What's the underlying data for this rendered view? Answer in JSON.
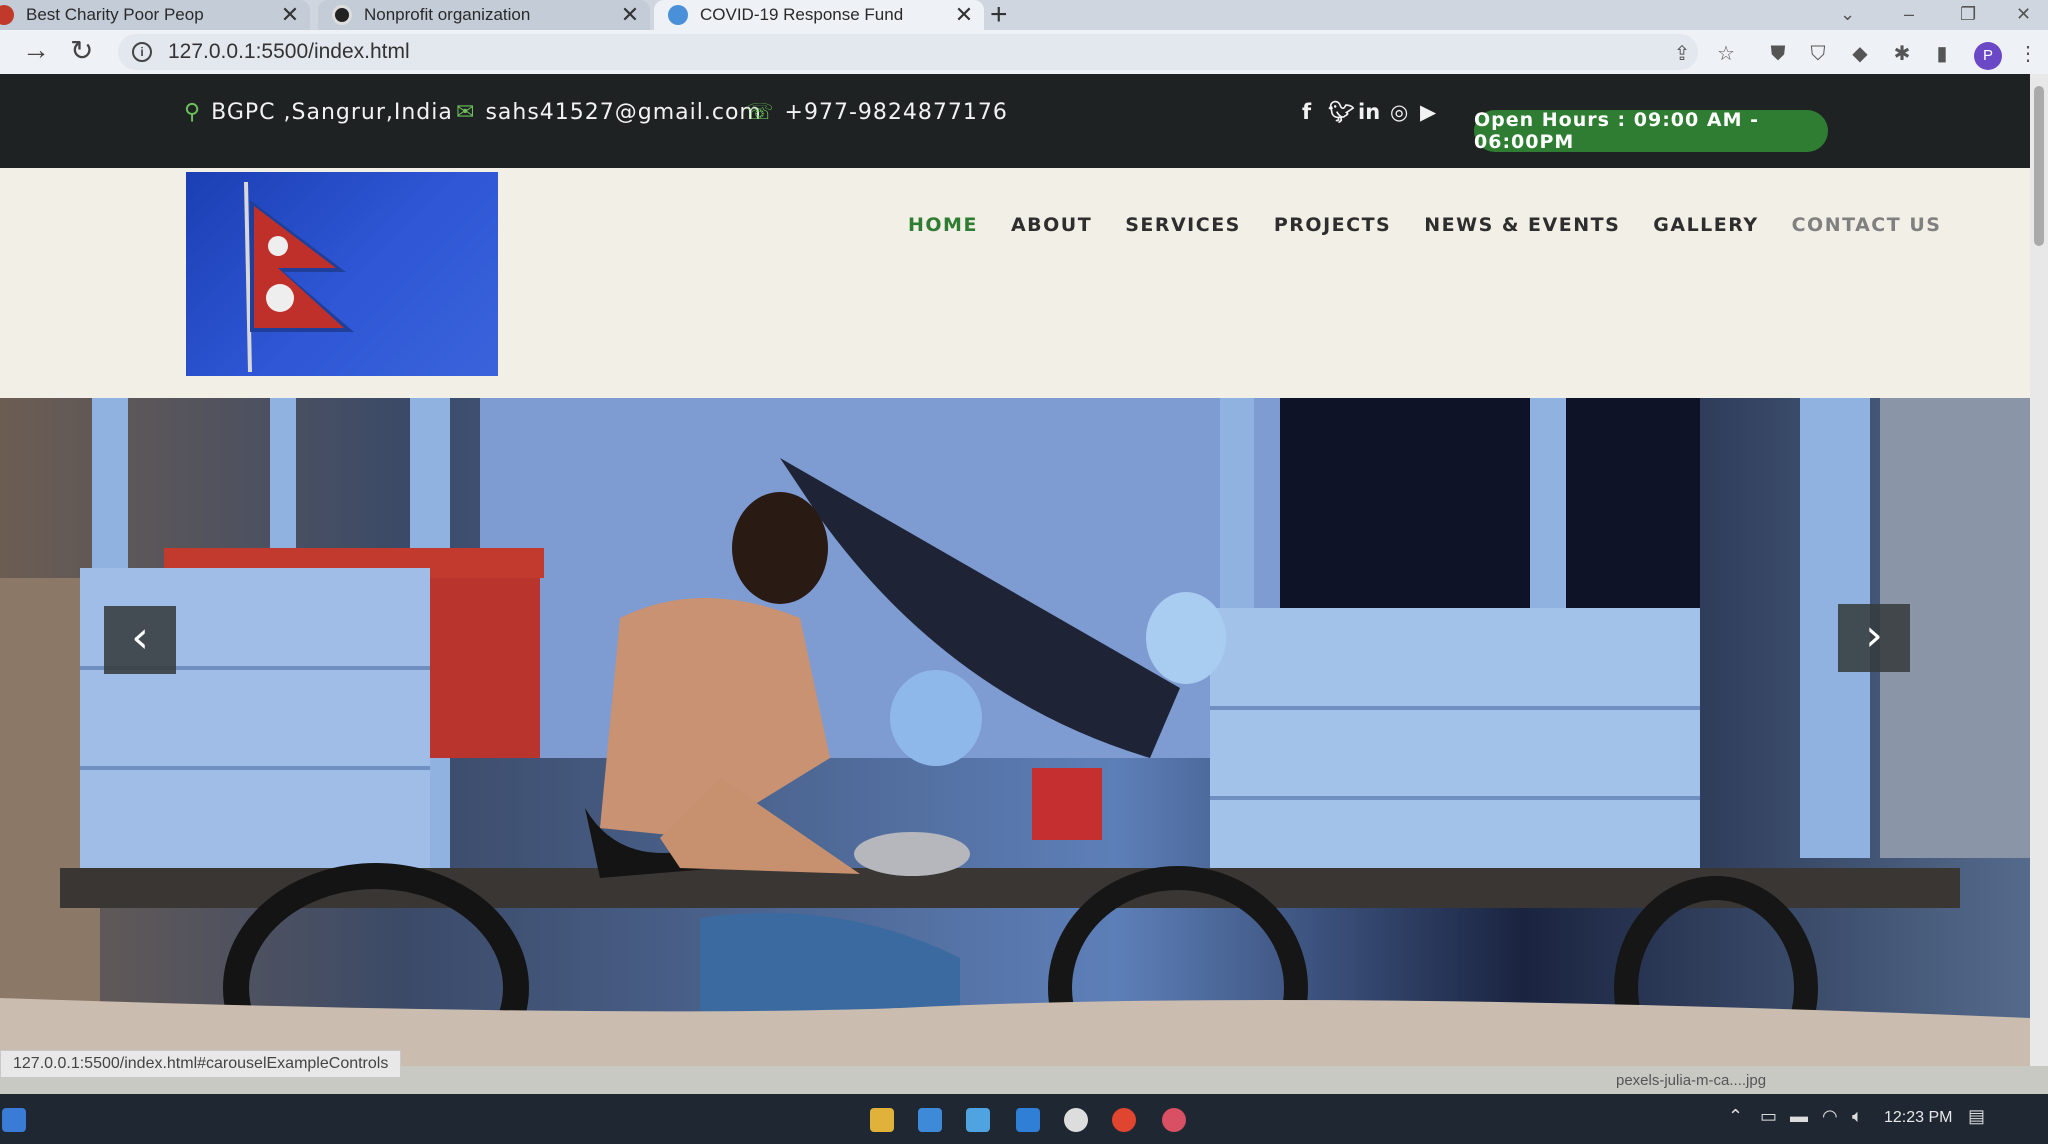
{
  "browser": {
    "tabs": [
      {
        "title": "Best Charity Poor Peop",
        "active": false
      },
      {
        "title": "Nonprofit organization",
        "active": false
      },
      {
        "title": "COVID-19 Response Fund",
        "active": true
      }
    ],
    "new_tab": "+",
    "address": "127.0.0.1:5500/index.html",
    "profile_initial": "P"
  },
  "topbar": {
    "address": "BGPC ,Sangrur,India",
    "email": "sahs41527@gmail.com",
    "phone": "+977-9824877176",
    "social_icons": [
      "facebook-icon",
      "twitter-icon",
      "linkedin-icon",
      "instagram-icon",
      "youtube-icon"
    ],
    "open_hours": "Open Hours : 09:00 AM - 06:00PM"
  },
  "nav": {
    "items": [
      {
        "label": "HOME",
        "state": "active"
      },
      {
        "label": "ABOUT",
        "state": ""
      },
      {
        "label": "SERVICES",
        "state": ""
      },
      {
        "label": "PROJECTS",
        "state": ""
      },
      {
        "label": "NEWS & EVENTS",
        "state": ""
      },
      {
        "label": "GALLERY",
        "state": ""
      },
      {
        "label": "CONTACT US",
        "state": "hover"
      }
    ]
  },
  "carousel": {
    "prev": "‹",
    "next": "›"
  },
  "statusbar": {
    "link_url": "127.0.0.1:5500/index.html#carouselExampleControls",
    "download_file": "pexels-julia-m-ca....jpg"
  },
  "taskbar": {
    "time": "12:23 PM"
  },
  "colors": {
    "accent_green": "#2f7d32",
    "topbar_bg": "#1e2222",
    "nav_bg": "#f2efe6"
  }
}
